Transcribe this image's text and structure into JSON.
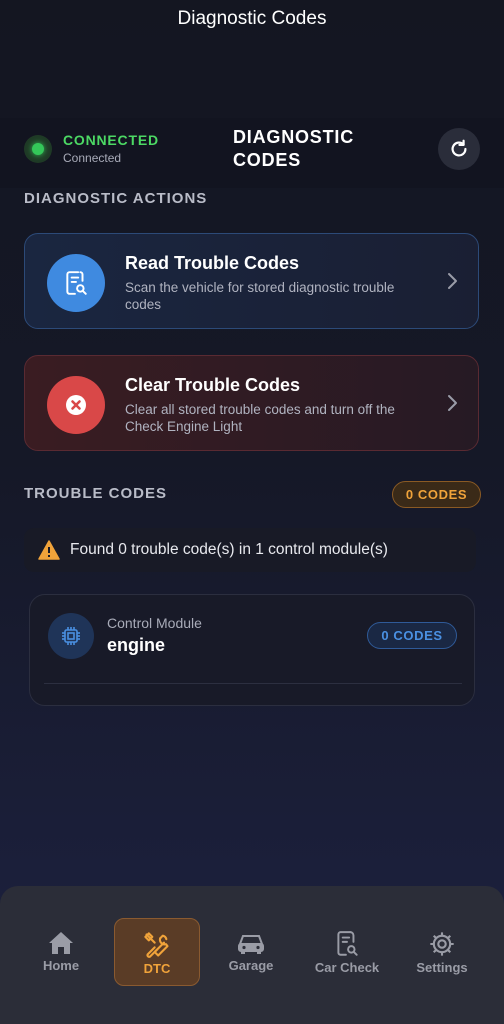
{
  "nav": {
    "title": "Diagnostic Codes"
  },
  "status": {
    "title": "CONNECTED",
    "subtitle": "Connected",
    "heading_line1": "DIAGNOSTIC",
    "heading_line2": "CODES"
  },
  "actions_section": {
    "label": "DIAGNOSTIC ACTIONS"
  },
  "actions": [
    {
      "title": "Read Trouble Codes",
      "description": "Scan the vehicle for stored diagnostic trouble codes",
      "icon": "document-search-icon"
    },
    {
      "title": "Clear Trouble Codes",
      "description": "Clear all stored trouble codes and turn off the Check Engine Light",
      "icon": "close-circle-icon"
    }
  ],
  "codes_section": {
    "label": "TROUBLE CODES",
    "badge": "0 CODES"
  },
  "summary": {
    "text": "Found 0 trouble code(s) in 1 control module(s)"
  },
  "module": {
    "label": "Control Module",
    "name": "engine",
    "badge": "0 CODES"
  },
  "tabs": [
    {
      "label": "Home",
      "icon": "house-icon"
    },
    {
      "label": "DTC",
      "icon": "tools-icon",
      "active": true
    },
    {
      "label": "Garage",
      "icon": "car-icon"
    },
    {
      "label": "Car Check",
      "icon": "report-icon"
    },
    {
      "label": "Settings",
      "icon": "gear-icon"
    }
  ],
  "colors": {
    "connected": "#34c759",
    "accent_orange": "#f0a33a",
    "accent_blue": "#4a90e2",
    "danger": "#d94848"
  }
}
